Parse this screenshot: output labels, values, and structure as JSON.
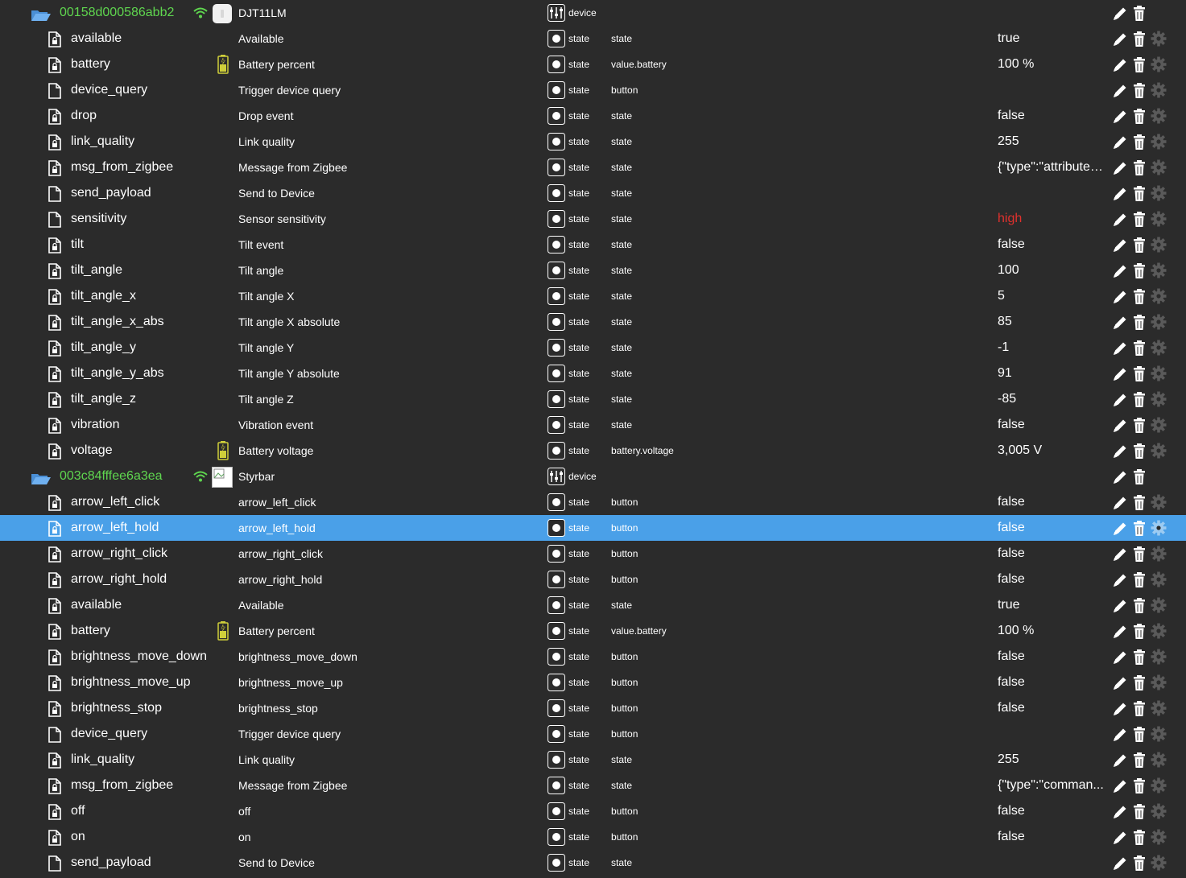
{
  "type_labels": {
    "device": "device",
    "state": "state"
  },
  "colors": {
    "background": "#2b2b2b",
    "folder_id": "#5fd64f",
    "selected_row": "#4aa0e8",
    "alert_value": "#e0312d"
  },
  "icons": {
    "folder": "folder-open-icon",
    "file_locked": "file-lock-icon",
    "file_plain": "file-icon",
    "wifi": "wifi-icon",
    "battery": "battery-icon",
    "device_type": "device-sliders-icon",
    "state_type": "state-dot-icon",
    "edit": "pencil-icon",
    "delete": "trash-icon",
    "settings": "gear-icon"
  },
  "rows": [
    {
      "kind": "folder",
      "id": "00158d000586abb2",
      "name": "DJT11LM",
      "type": "device",
      "image": "light",
      "actions": 2
    },
    {
      "kind": "state",
      "id": "available",
      "name": "Available",
      "type": "state",
      "role": "state",
      "value": "true",
      "file": "lock"
    },
    {
      "kind": "state",
      "id": "battery",
      "name": "Battery percent",
      "type": "state",
      "role": "value.battery",
      "value": "100 %",
      "file": "lock",
      "battery": true
    },
    {
      "kind": "state",
      "id": "device_query",
      "name": "Trigger device query",
      "type": "state",
      "role": "button",
      "value": "",
      "file": "plain"
    },
    {
      "kind": "state",
      "id": "drop",
      "name": "Drop event",
      "type": "state",
      "role": "state",
      "value": "false",
      "file": "lock"
    },
    {
      "kind": "state",
      "id": "link_quality",
      "name": "Link quality",
      "type": "state",
      "role": "state",
      "value": "255",
      "file": "lock"
    },
    {
      "kind": "state",
      "id": "msg_from_zigbee",
      "name": "Message from Zigbee",
      "type": "state",
      "role": "state",
      "value": "{\"type\":\"attributeR...",
      "file": "lock"
    },
    {
      "kind": "state",
      "id": "send_payload",
      "name": "Send to Device",
      "type": "state",
      "role": "state",
      "value": "",
      "file": "plain"
    },
    {
      "kind": "state",
      "id": "sensitivity",
      "name": "Sensor sensitivity",
      "type": "state",
      "role": "state",
      "value": "high",
      "file": "plain",
      "alert": true
    },
    {
      "kind": "state",
      "id": "tilt",
      "name": "Tilt event",
      "type": "state",
      "role": "state",
      "value": "false",
      "file": "lock"
    },
    {
      "kind": "state",
      "id": "tilt_angle",
      "name": "Tilt angle",
      "type": "state",
      "role": "state",
      "value": "100",
      "file": "lock"
    },
    {
      "kind": "state",
      "id": "tilt_angle_x",
      "name": "Tilt angle X",
      "type": "state",
      "role": "state",
      "value": "5",
      "file": "lock"
    },
    {
      "kind": "state",
      "id": "tilt_angle_x_abs",
      "name": "Tilt angle X absolute",
      "type": "state",
      "role": "state",
      "value": "85",
      "file": "lock"
    },
    {
      "kind": "state",
      "id": "tilt_angle_y",
      "name": "Tilt angle Y",
      "type": "state",
      "role": "state",
      "value": "-1",
      "file": "lock"
    },
    {
      "kind": "state",
      "id": "tilt_angle_y_abs",
      "name": "Tilt angle Y absolute",
      "type": "state",
      "role": "state",
      "value": "91",
      "file": "lock"
    },
    {
      "kind": "state",
      "id": "tilt_angle_z",
      "name": "Tilt angle Z",
      "type": "state",
      "role": "state",
      "value": "-85",
      "file": "lock"
    },
    {
      "kind": "state",
      "id": "vibration",
      "name": "Vibration event",
      "type": "state",
      "role": "state",
      "value": "false",
      "file": "lock"
    },
    {
      "kind": "state",
      "id": "voltage",
      "name": "Battery voltage",
      "type": "state",
      "role": "battery.voltage",
      "value": "3,005 V",
      "file": "lock",
      "battery": true
    },
    {
      "kind": "folder",
      "id": "003c84fffee6a3ea",
      "name": "Styrbar",
      "type": "device",
      "image": "broken",
      "actions": 2
    },
    {
      "kind": "state",
      "id": "arrow_left_click",
      "name": "arrow_left_click",
      "type": "state",
      "role": "button",
      "value": "false",
      "file": "lock"
    },
    {
      "kind": "state",
      "id": "arrow_left_hold",
      "name": "arrow_left_hold",
      "type": "state",
      "role": "button",
      "value": "false",
      "file": "lock",
      "selected": true
    },
    {
      "kind": "state",
      "id": "arrow_right_click",
      "name": "arrow_right_click",
      "type": "state",
      "role": "button",
      "value": "false",
      "file": "lock"
    },
    {
      "kind": "state",
      "id": "arrow_right_hold",
      "name": "arrow_right_hold",
      "type": "state",
      "role": "button",
      "value": "false",
      "file": "lock"
    },
    {
      "kind": "state",
      "id": "available",
      "name": "Available",
      "type": "state",
      "role": "state",
      "value": "true",
      "file": "lock"
    },
    {
      "kind": "state",
      "id": "battery",
      "name": "Battery percent",
      "type": "state",
      "role": "value.battery",
      "value": "100 %",
      "file": "lock",
      "battery": true
    },
    {
      "kind": "state",
      "id": "brightness_move_down",
      "name": "brightness_move_down",
      "type": "state",
      "role": "button",
      "value": "false",
      "file": "lock"
    },
    {
      "kind": "state",
      "id": "brightness_move_up",
      "name": "brightness_move_up",
      "type": "state",
      "role": "button",
      "value": "false",
      "file": "lock"
    },
    {
      "kind": "state",
      "id": "brightness_stop",
      "name": "brightness_stop",
      "type": "state",
      "role": "button",
      "value": "false",
      "file": "lock"
    },
    {
      "kind": "state",
      "id": "device_query",
      "name": "Trigger device query",
      "type": "state",
      "role": "button",
      "value": "",
      "file": "plain"
    },
    {
      "kind": "state",
      "id": "link_quality",
      "name": "Link quality",
      "type": "state",
      "role": "state",
      "value": "255",
      "file": "lock"
    },
    {
      "kind": "state",
      "id": "msg_from_zigbee",
      "name": "Message from Zigbee",
      "type": "state",
      "role": "state",
      "value": "{\"type\":\"comman...",
      "file": "lock"
    },
    {
      "kind": "state",
      "id": "off",
      "name": "off",
      "type": "state",
      "role": "button",
      "value": "false",
      "file": "lock"
    },
    {
      "kind": "state",
      "id": "on",
      "name": "on",
      "type": "state",
      "role": "button",
      "value": "false",
      "file": "lock"
    },
    {
      "kind": "state",
      "id": "send_payload",
      "name": "Send to Device",
      "type": "state",
      "role": "state",
      "value": "",
      "file": "plain"
    }
  ]
}
